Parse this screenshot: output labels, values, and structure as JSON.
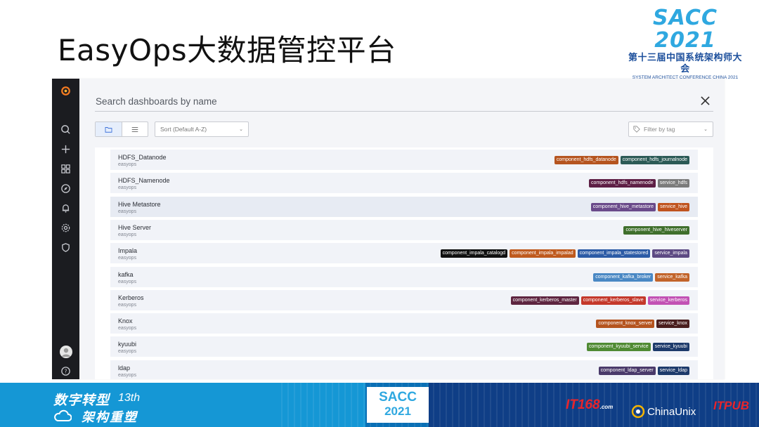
{
  "slide": {
    "title": "EasyOps大数据管控平台",
    "logo_main": "SACC 2021",
    "logo_cn": "第十三届中国系统架构师大会",
    "logo_en": "SYSTEM ARCHITECT CONFERENCE CHINA 2021"
  },
  "search": {
    "placeholder": "Search dashboards by name"
  },
  "toolbar": {
    "sort_label": "Sort (Default A-Z)",
    "tag_filter_label": "Filter by tag"
  },
  "dashboards": [
    {
      "title": "HDFS_Datanode",
      "folder": "easyops",
      "tags": [
        {
          "label": "component_hdfs_datanode",
          "color": "#b5541f"
        },
        {
          "label": "component_hdfs_journalnode",
          "color": "#2b5a56"
        }
      ]
    },
    {
      "title": "HDFS_Namenode",
      "folder": "easyops",
      "tags": [
        {
          "label": "component_hdfs_namenode",
          "color": "#5e1f45"
        },
        {
          "label": "service_hdfs",
          "color": "#7b7b7b"
        }
      ]
    },
    {
      "title": "Hive Metastore",
      "folder": "easyops",
      "tags": [
        {
          "label": "component_hive_metastore",
          "color": "#6a4a8a"
        },
        {
          "label": "service_hive",
          "color": "#c0541f"
        }
      ]
    },
    {
      "title": "Hive Server",
      "folder": "easyops",
      "tags": [
        {
          "label": "component_hive_hiveserver",
          "color": "#3f6f2c"
        }
      ]
    },
    {
      "title": "Impala",
      "folder": "easyops",
      "tags": [
        {
          "label": "component_impala_catalogd",
          "color": "#111111"
        },
        {
          "label": "component_impala_impalad",
          "color": "#bf5a1e"
        },
        {
          "label": "component_impala_statestored",
          "color": "#2c5ba6"
        },
        {
          "label": "service_impala",
          "color": "#5d4a83"
        }
      ]
    },
    {
      "title": "kafka",
      "folder": "easyops",
      "tags": [
        {
          "label": "component_kafka_broker",
          "color": "#4a88c4"
        },
        {
          "label": "service_kafka",
          "color": "#c2642a"
        }
      ]
    },
    {
      "title": "Kerberos",
      "folder": "easyops",
      "tags": [
        {
          "label": "component_kerberos_master",
          "color": "#5e2540"
        },
        {
          "label": "component_kerberos_slave",
          "color": "#c4382b"
        },
        {
          "label": "service_kerberos",
          "color": "#c251b4"
        }
      ]
    },
    {
      "title": "Knox",
      "folder": "easyops",
      "tags": [
        {
          "label": "component_knox_server",
          "color": "#b5541f"
        },
        {
          "label": "service_knox",
          "color": "#4a1e1e"
        }
      ]
    },
    {
      "title": "kyuubi",
      "folder": "easyops",
      "tags": [
        {
          "label": "component_kyuubi_service",
          "color": "#4f8a33"
        },
        {
          "label": "service_kyuubi",
          "color": "#1d3a6b"
        }
      ]
    },
    {
      "title": "ldap",
      "folder": "easyops",
      "tags": [
        {
          "label": "component_ldap_server",
          "color": "#4a3a6a"
        },
        {
          "label": "service_ldap",
          "color": "#1d3a6b"
        }
      ]
    }
  ],
  "banner": {
    "cn_line1": "数字转型",
    "edition": "13th",
    "cn_line2": "架构重塑",
    "sacc_top": "SACC",
    "sacc_year": "2021",
    "it168": "IT168",
    "it168_suffix": ".com",
    "chinaunix": "ChinaUnix",
    "itpub": "ITPUB"
  }
}
